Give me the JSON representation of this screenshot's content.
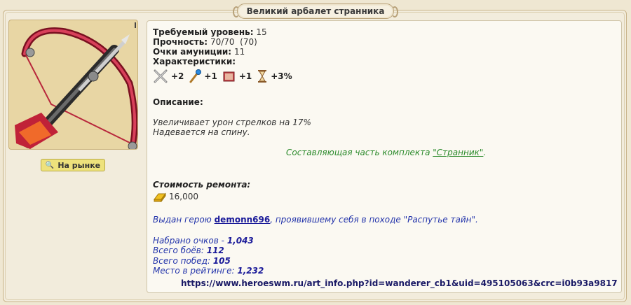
{
  "item": {
    "title": "Великий арбалет странника"
  },
  "market_button": {
    "label": "На рынке"
  },
  "requirements": {
    "level_label": "Требуемый уровень:",
    "level_value": "15",
    "durability_label": "Прочность:",
    "durability_value": "70/70  (70)",
    "ammo_label": "Очки амуниции:",
    "ammo_value": "11",
    "stats_label": "Характеристики:"
  },
  "stats": [
    {
      "icon": "swords-icon",
      "value": "+2"
    },
    {
      "icon": "wand-icon",
      "value": "+1"
    },
    {
      "icon": "book-icon",
      "value": "+1"
    },
    {
      "icon": "hourglass-icon",
      "value": "+3%"
    }
  ],
  "description": {
    "heading": "Описание:",
    "line1": "Увеличивает урон стрелков на 17%",
    "line2": "Надевается на спину.",
    "set_prefix": "Составляющая часть комплекта ",
    "set_name": "\"Странник\"",
    "set_suffix": "."
  },
  "repair": {
    "heading": "Стоимость ремонта:",
    "cost": "16,000"
  },
  "issued": {
    "prefix": "Выдан герою ",
    "hero": "demonn696",
    "suffix": ", проявившему себя в походе \"Распутье тайн\"."
  },
  "results": {
    "points_label": "Набрано очков - ",
    "points_value": "1,043",
    "battles_label": "Всего боёв: ",
    "battles_value": "112",
    "wins_label": "Всего побед: ",
    "wins_value": "105",
    "rank_label": "Место в рейтинге: ",
    "rank_value": "1,232"
  },
  "url": "https://www.heroeswm.ru/art_info.php?id=wanderer_cb1&uid=495105063&crc=i0b93a9817"
}
